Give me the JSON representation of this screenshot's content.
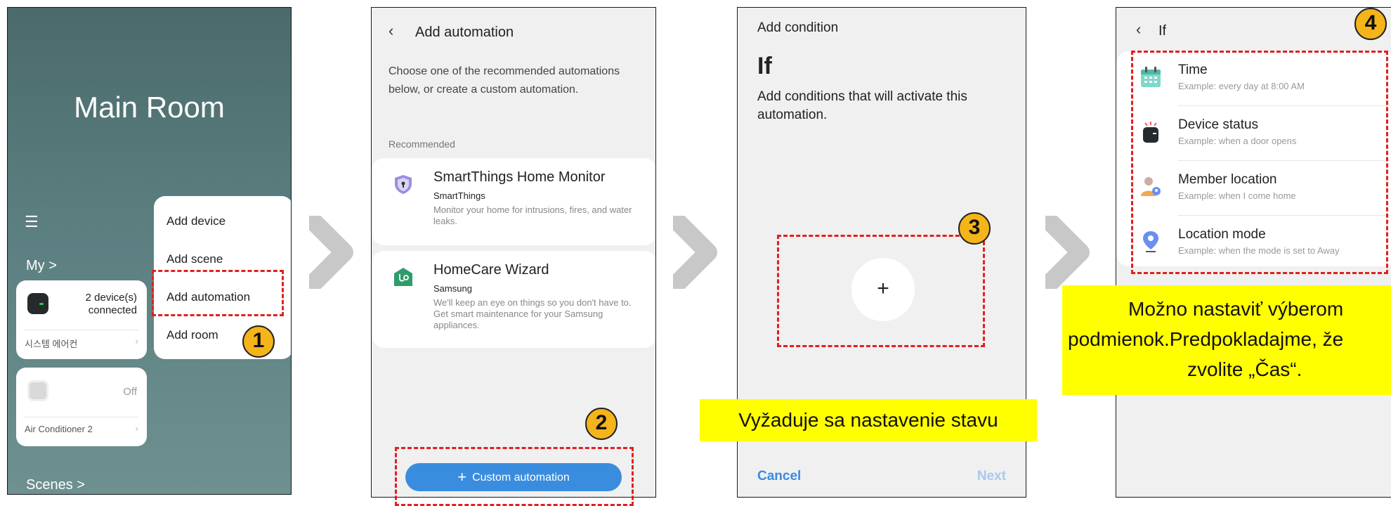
{
  "panel1": {
    "room_title": "Main Room",
    "menu_icon": "hamburger-menu-icon",
    "my_label": "My >",
    "scenes_label": "Scenes >",
    "devices": [
      {
        "status": "2 device(s) connected",
        "name": "시스템 에어컨",
        "icon": "air-conditioner-icon"
      },
      {
        "status": "Off",
        "name": "Air Conditioner 2",
        "icon": "air-conditioner-icon"
      }
    ],
    "popup_menu": [
      "Add device",
      "Add scene",
      "Add automation",
      "Add room"
    ]
  },
  "panel2": {
    "back_icon": "chevron-left-icon",
    "title": "Add automation",
    "intro": "Choose one of the recommended automations below, or create a custom automation.",
    "recommended_label": "Recommended",
    "recommendations": [
      {
        "title": "SmartThings Home Monitor",
        "publisher": "SmartThings",
        "description": "Monitor your home for intrusions, fires, and water leaks.",
        "icon": "shield-icon"
      },
      {
        "title": "HomeCare Wizard",
        "publisher": "Samsung",
        "description": "We'll keep an eye on things so you don't have to. Get smart maintenance for your Samsung appliances.",
        "icon": "stethoscope-house-icon"
      }
    ],
    "custom_button": "Custom automation"
  },
  "panel3": {
    "title": "Add condition",
    "heading": "If",
    "subtitle": "Add conditions that will activate this automation.",
    "add_symbol": "+",
    "cancel_label": "Cancel",
    "next_label": "Next"
  },
  "panel4": {
    "back_icon": "chevron-left-icon",
    "title": "If",
    "conditions": [
      {
        "title": "Time",
        "example": "Example: every day at 8:00 AM",
        "icon": "calendar-icon"
      },
      {
        "title": "Device status",
        "example": "Example: when a door opens",
        "icon": "device-alert-icon"
      },
      {
        "title": "Member location",
        "example": "Example: when I come home",
        "icon": "member-location-icon"
      },
      {
        "title": "Location mode",
        "example": "Example: when the mode is set to Away",
        "icon": "location-pin-icon"
      }
    ]
  },
  "annotations": {
    "steps": [
      "1",
      "2",
      "3",
      "4"
    ],
    "note_condition": "Vyžaduje sa nastavenie stavu",
    "note_select": "Možno nastaviť výberom podmienok.Predpokladajme, že zvolite „Čas“."
  },
  "colors": {
    "accent_blue": "#3a8dde",
    "annotation_red": "#e02020",
    "step_badge": "#f4b41a",
    "note_yellow": "#ffff00",
    "arrow_gray": "#c8c8c8"
  }
}
